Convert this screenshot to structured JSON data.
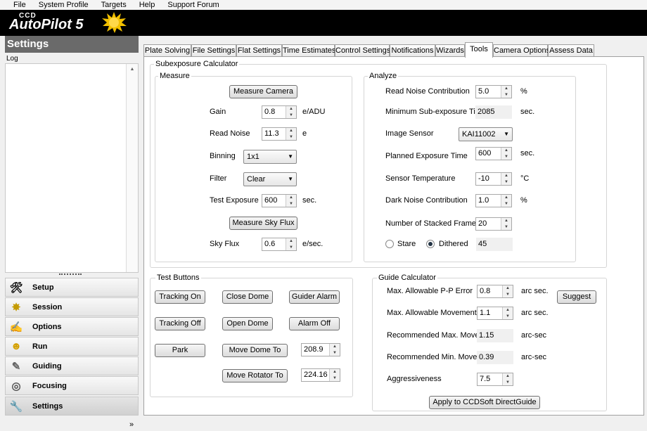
{
  "menu": [
    "File",
    "System Profile",
    "Targets",
    "Help",
    "Support Forum"
  ],
  "logo": {
    "top": "CCD",
    "main": "AutoPilot 5"
  },
  "sidebar": {
    "header": "Settings",
    "log_label": "Log",
    "more": "»",
    "items": [
      {
        "label": "Setup",
        "icon": "wrench-screwdriver-icon"
      },
      {
        "label": "Session",
        "icon": "star-burst-icon"
      },
      {
        "label": "Options",
        "icon": "checklist-icon"
      },
      {
        "label": "Run",
        "icon": "run-icon"
      },
      {
        "label": "Guiding",
        "icon": "guiding-icon"
      },
      {
        "label": "Focusing",
        "icon": "focus-icon"
      },
      {
        "label": "Settings",
        "icon": "settings-wrench-icon"
      }
    ]
  },
  "tabs": [
    "Plate Solving",
    "File Settings",
    "Flat Settings",
    "Time Estimates",
    "Control Settings",
    "Notifications",
    "Wizards",
    "Tools",
    "Camera Options",
    "Assess Data"
  ],
  "selected_tab": "Tools",
  "subexposure": {
    "title": "Subexposure Calculator",
    "measure": {
      "title": "Measure",
      "measure_camera": "Measure Camera",
      "gain_label": "Gain",
      "gain_value": "0.8",
      "gain_unit": "e/ADU",
      "read_noise_label": "Read Noise",
      "read_noise_value": "11.3",
      "read_noise_unit": "e",
      "binning_label": "Binning",
      "binning_value": "1x1",
      "filter_label": "Filter",
      "filter_value": "Clear",
      "test_exposure_label": "Test Exposure",
      "test_exposure_value": "600",
      "test_exposure_unit": "sec.",
      "measure_sky_flux": "Measure Sky Flux",
      "sky_flux_label": "Sky Flux",
      "sky_flux_value": "0.6",
      "sky_flux_unit": "e/sec."
    },
    "analyze": {
      "title": "Analyze",
      "read_noise_contrib_label": "Read Noise Contribution",
      "read_noise_contrib_value": "5.0",
      "read_noise_contrib_unit": "%",
      "min_sub_label": "Minimum Sub-exposure Time",
      "min_sub_value": "2085",
      "min_sub_unit": "sec.",
      "sensor_label": "Image Sensor",
      "sensor_value": "KAI11002",
      "planned_label": "Planned Exposure Time",
      "planned_value": "600",
      "planned_unit": "sec.",
      "temp_label": "Sensor Temperature",
      "temp_value": "-10",
      "temp_unit": "°C",
      "dark_label": "Dark Noise Contribution",
      "dark_value": "1.0",
      "dark_unit": "%",
      "stacked_label": "Number of Stacked Frames",
      "stacked_value": "20",
      "stare_label": "Stare",
      "dithered_label": "Dithered",
      "dither_result": "45"
    }
  },
  "test_buttons": {
    "title": "Test Buttons",
    "tracking_on": "Tracking On",
    "close_dome": "Close Dome",
    "guider_alarm": "Guider Alarm",
    "tracking_off": "Tracking Off",
    "open_dome": "Open Dome",
    "alarm_off": "Alarm Off",
    "park": "Park",
    "move_dome": "Move Dome To",
    "dome_value": "208.9",
    "move_rotator": "Move Rotator To",
    "rotator_value": "224.16"
  },
  "guide": {
    "title": "Guide Calculator",
    "max_pp_label": "Max. Allowable P-P Error",
    "max_pp_value": "0.8",
    "max_pp_unit": "arc sec.",
    "max_move_label": "Max. Allowable Movement",
    "max_move_value": "1.1",
    "max_move_unit": "arc sec.",
    "rec_max_label": "Recommended Max. Move",
    "rec_max_value": "1.15",
    "rec_max_unit": "arc-sec",
    "rec_min_label": "Recommended Min. Move",
    "rec_min_value": "0.39",
    "rec_min_unit": "arc-sec",
    "aggr_label": "Aggressiveness",
    "aggr_value": "7.5",
    "suggest": "Suggest",
    "apply": "Apply to CCDSoft DirectGuide"
  }
}
